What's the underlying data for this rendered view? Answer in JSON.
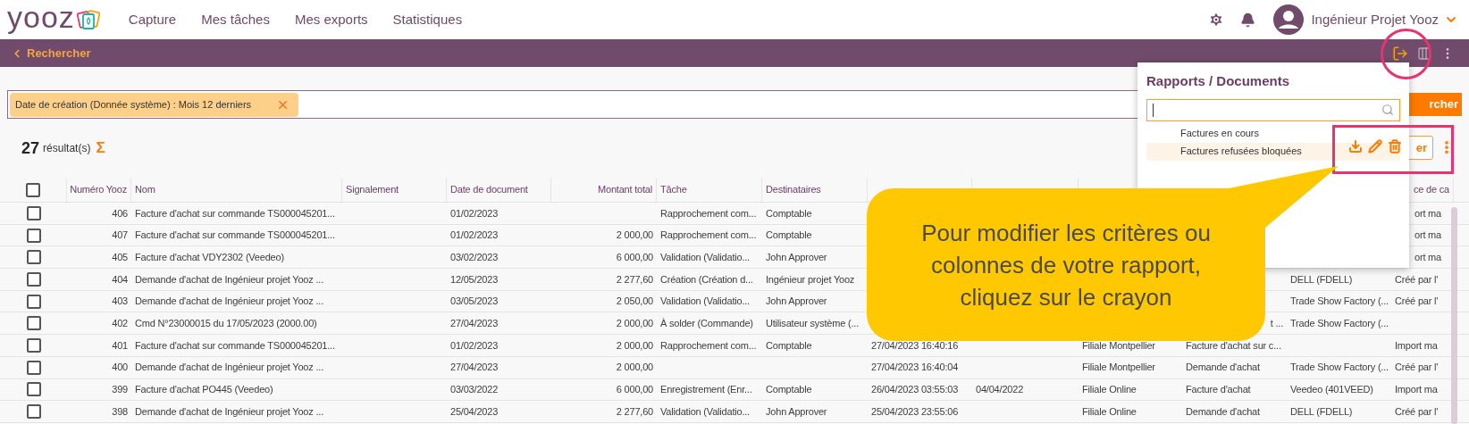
{
  "nav": {
    "logo": "yooz",
    "items": [
      {
        "label": "Capture"
      },
      {
        "label": "Mes tâches"
      },
      {
        "label": "Mes exports"
      },
      {
        "label": "Statistiques"
      }
    ],
    "user": "Ingénieur Projet Yooz"
  },
  "toolbar": {
    "back": "Rechercher"
  },
  "filter": {
    "chips": [
      {
        "label": "Date de création (Donnée système) : Mois 12 derniers"
      }
    ],
    "search_button": "rcher"
  },
  "results": {
    "count": "27",
    "label": "résultat(s)",
    "sum_symbol": "Σ"
  },
  "table": {
    "all_checked": false,
    "columns": [
      "Numéro Yooz",
      "Nom",
      "Signalement",
      "Date de document",
      "Montant total",
      "Tâche",
      "Destinataires",
      null,
      null,
      null,
      null,
      null,
      {
        "text": "ce de ca",
        "clipped": true
      }
    ],
    "rows": [
      {
        "checked": false,
        "cells": [
          "406",
          "Facture d'achat sur commande TS000045201...",
          null,
          "01/02/2023",
          null,
          "Rapprochement com...",
          "Comptable",
          null,
          null,
          null,
          null,
          null,
          {
            "text": "ort ma",
            "clipped": true
          }
        ]
      },
      {
        "checked": false,
        "cells": [
          "407",
          "Facture d'achat sur commande TS000045201...",
          null,
          "01/02/2023",
          "2 000,00",
          "Rapprochement com...",
          "Comptable",
          null,
          null,
          null,
          null,
          null,
          {
            "text": "ort ma",
            "clipped": true
          }
        ]
      },
      {
        "checked": false,
        "cells": [
          "405",
          "Facture d'achat VDY2302 (Veedeo)",
          null,
          "03/02/2023",
          "6 000,00",
          "Validation (Validatio...",
          "John Approver",
          null,
          null,
          null,
          null,
          null,
          {
            "text": "ort ma",
            "clipped": true
          }
        ]
      },
      {
        "checked": false,
        "cells": [
          "404",
          "Demande d'achat de Ingénieur projet Yooz ...",
          null,
          "12/05/2023",
          "2 277,60",
          "Création (Création d...",
          "Ingénieur projet Yooz",
          null,
          null,
          null,
          null,
          "DELL (FDELL)",
          "Créé par l'"
        ]
      },
      {
        "checked": false,
        "cells": [
          "403",
          "Demande d'achat de Ingénieur projet Yooz ...",
          null,
          "03/05/2023",
          "2 050,00",
          "Validation (Validatio...",
          "John Approver",
          null,
          null,
          null,
          null,
          "Trade Show Factory (...",
          "Créé par l'"
        ]
      },
      {
        "checked": false,
        "cells": [
          "402",
          "Cmd N°23000015 du 17/05/2023 (2000.00)",
          null,
          "27/04/2023",
          "2 000,00",
          "À solder (Commande)",
          "Utilisateur système (...",
          null,
          null,
          null,
          {
            "text": "t ...",
            "clipped": true
          },
          "Trade Show Factory (...",
          null
        ]
      },
      {
        "checked": false,
        "cells": [
          "401",
          "Facture d'achat sur commande TS000045201...",
          null,
          "01/02/2023",
          "2 000,00",
          "Rapprochement com...",
          "Comptable",
          "27/04/2023 16:40:16",
          null,
          "Filiale Montpellier",
          "Facture d'achat sur c...",
          null,
          "Import ma"
        ]
      },
      {
        "checked": false,
        "cells": [
          "400",
          "Demande d'achat de Ingénieur projet Yooz ...",
          null,
          "27/04/2023",
          "2 000,00",
          null,
          null,
          "27/04/2023 16:40:04",
          null,
          "Filiale Montpellier",
          "Demande d'achat",
          "Trade Show Factory (...",
          "Créé par l'"
        ]
      },
      {
        "checked": false,
        "cells": [
          "399",
          "Facture d'achat PO445 (Veedeo)",
          null,
          "03/03/2022",
          "6 000,00",
          "Enregistrement (Enr...",
          "Comptable",
          "26/04/2023 03:55:03",
          "04/04/2022",
          "Filiale Online",
          "Facture d'achat",
          "Veedeo (401VEED)",
          "Import ma"
        ]
      },
      {
        "checked": false,
        "cells": [
          "398",
          "Demande d'achat de Ingénieur projet Yooz ...",
          null,
          "25/04/2023",
          "2 277,60",
          "Validation (Validatio...",
          "John Approver",
          "25/04/2023 23:55:06",
          null,
          "Filiale Online",
          "Demande d'achat",
          "DELL (FDELL)",
          "Créé par l'"
        ]
      }
    ]
  },
  "behind_button": "er",
  "reports_panel": {
    "title": "Rapports / Documents",
    "items": [
      {
        "label": "Factures en cours",
        "selected": false
      },
      {
        "label": "Factures refusées bloquées",
        "selected": true
      }
    ]
  },
  "callout": {
    "text": "Pour modifier les critères ou colonnes de votre rapport, cliquez sur le crayon"
  }
}
